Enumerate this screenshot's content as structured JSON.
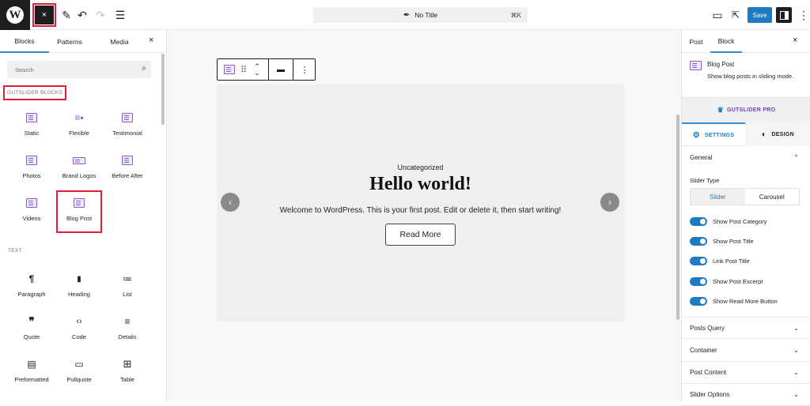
{
  "topbar": {
    "logo": "W",
    "close_inserter_icon": "×",
    "tools_icon": "✎",
    "undo_icon": "↶",
    "redo_icon": "↷",
    "outline_icon": "☰",
    "command_bar": {
      "icon": "feather-icon",
      "title": "No Title",
      "shortcut": "⌘K"
    },
    "view_icon": "▭",
    "preview_icon": "⇱",
    "save_label": "Save",
    "more_icon": "⋮"
  },
  "inserter": {
    "tabs": [
      "Blocks",
      "Patterns",
      "Media"
    ],
    "active_tab": "Blocks",
    "close_icon": "×",
    "search_placeholder": "Search",
    "categories": [
      {
        "label": "GUTSLIDER BLOCKS",
        "blocks": [
          "Static",
          "Flexible",
          "Testimonial",
          "Photos",
          "Brand Logos",
          "Before After",
          "Videos",
          "Blog Post"
        ]
      },
      {
        "label": "TEXT",
        "blocks": [
          "Paragraph",
          "Heading",
          "List",
          "Quote",
          "Code",
          "Details",
          "Preformatted",
          "Pullquote",
          "Table"
        ],
        "icons": [
          "¶",
          "▮",
          "≔",
          "❞",
          "‹›",
          "≡",
          "▤",
          "▭",
          "⊞"
        ]
      }
    ]
  },
  "canvas": {
    "block_toolbar": {
      "block_icon": "blog-post-icon",
      "drag_icon": "⠿",
      "move_up": "⌃",
      "move_down": "⌄",
      "align_icon": "▬",
      "more_icon": "⋮"
    },
    "slide": {
      "category": "Uncategorized",
      "title": "Hello world!",
      "excerpt": "Welcome to WordPress. This is your first post. Edit or delete it, then start writing!",
      "button": "Read More",
      "prev_icon": "‹",
      "next_icon": "›"
    }
  },
  "sidebar": {
    "tabs": [
      "Post",
      "Block"
    ],
    "active_tab": "Block",
    "close_icon": "×",
    "block_card": {
      "title": "Blog Post",
      "description": "Show blog posts in sliding mode."
    },
    "pro_label": "GUTSLIDER PRO",
    "settings_tab": "SETTINGS",
    "design_tab": "DESIGN",
    "general": {
      "title": "General",
      "slider_type_label": "Slider Type",
      "slider_type_options": [
        "Slider",
        "Carousel"
      ],
      "slider_type_selected": "Slider",
      "toggles": [
        {
          "label": "Show Post Category",
          "on": true
        },
        {
          "label": "Show Post Title",
          "on": true
        },
        {
          "label": "Link Post Title",
          "on": true
        },
        {
          "label": "Show Post Excerpt",
          "on": true
        },
        {
          "label": "Show Read More Button",
          "on": true
        }
      ]
    },
    "panels": [
      "Posts Query",
      "Container",
      "Post Content",
      "Slider Options"
    ]
  }
}
